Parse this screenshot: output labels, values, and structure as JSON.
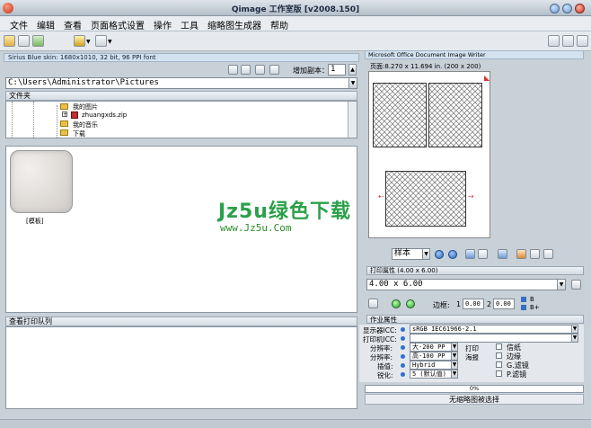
{
  "app": {
    "title": "Qimage 工作室版 [v2008.150]"
  },
  "menu": [
    "文件",
    "编辑",
    "查看",
    "页面格式设置",
    "操作",
    "工具",
    "缩略图生成器",
    "帮助"
  ],
  "skin_info": "Sirius Blue skin: 1680x1010, 32 bit, 96 PPI font",
  "copies": {
    "label": "增加副本：",
    "value": "1"
  },
  "path": {
    "value": "C:\\Users\\Administrator\\Pictures"
  },
  "folders": {
    "header": "文件夹",
    "items": [
      "我的图片",
      "zhuangxds.zip",
      "我的音乐",
      "下载"
    ]
  },
  "thumbnail": {
    "label": "[模板]"
  },
  "queue": {
    "header": "查看打印队列"
  },
  "printer": {
    "tab": "Microsoft Office Document Image Writer",
    "page_size": "页面:8.270 x 11.694 in.  (200 x 200)"
  },
  "zoom_select": {
    "value": "样本"
  },
  "print_props": {
    "header": "打印属性 (4.00 x 6.00)",
    "size_value": "4.00 x 6.00",
    "border_label": "边框:",
    "border_a_num": "1",
    "border_a": "0.00",
    "border_b_num": "2",
    "border_b": "0.00",
    "b_label": "B",
    "bplus_label": "B+"
  },
  "job_props": {
    "header": "作业属性",
    "display_icc_label": "显示器ICC:",
    "display_icc_value": "sRGB IEC61966-2.1",
    "printer_icc_label": "打印机ICC:",
    "printer_icc_value": "",
    "res_label": "分辨率:",
    "res_value": "大-200 PP",
    "res_side": "打印",
    "res2_label": "分辨率:",
    "res2_value": "高-100 PP",
    "res2_side": "海报",
    "interp_label": "插值:",
    "interp_value": "Hybrid",
    "sharpen_label": "锐化:",
    "sharpen_value": "5 (默认值)",
    "checks": [
      "信纸",
      "边缘",
      "G.滤镜",
      "P.滤镜"
    ]
  },
  "progress": {
    "value": "0%",
    "fraction": 0
  },
  "status": {
    "text": "无缩略图被选择"
  },
  "watermark": {
    "main": "Jz5u绿色下载",
    "sub": "www.Jz5u.Com"
  }
}
